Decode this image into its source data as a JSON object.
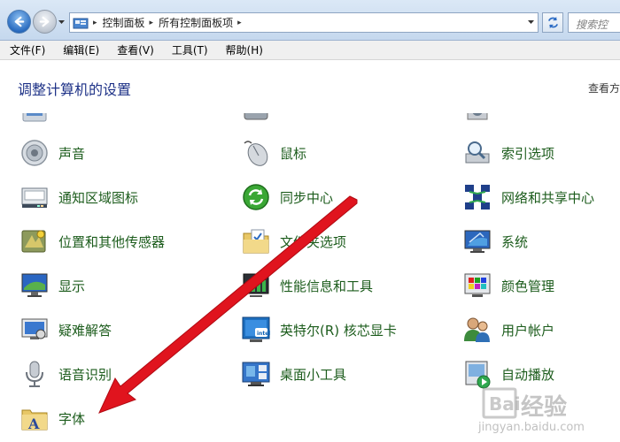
{
  "address_bar": {
    "crumbs": [
      "控制面板",
      "所有控制面板项"
    ],
    "search_placeholder": "搜索控"
  },
  "menu": [
    "文件(F)",
    "编辑(E)",
    "查看(V)",
    "工具(T)",
    "帮助(H)"
  ],
  "heading": "调整计算机的设置",
  "view_by": "查看方",
  "items": {
    "col1": [
      "声音",
      "通知区域图标",
      "位置和其他传感器",
      "显示",
      "疑难解答",
      "语音识别",
      "字体"
    ],
    "col2": [
      "鼠标",
      "同步中心",
      "文件夹选项",
      "性能信息和工具",
      "英特尔(R) 核芯显卡",
      "桌面小工具"
    ],
    "col3": [
      "索引选项",
      "网络和共享中心",
      "系统",
      "颜色管理",
      "用户帐户",
      "自动播放"
    ]
  },
  "watermark": {
    "logo_text": "经验",
    "site": "jingyan.baidu.com"
  },
  "colors": {
    "arrow": "#e0141e",
    "label": "#1c5c1c",
    "heading": "#1e3287"
  }
}
